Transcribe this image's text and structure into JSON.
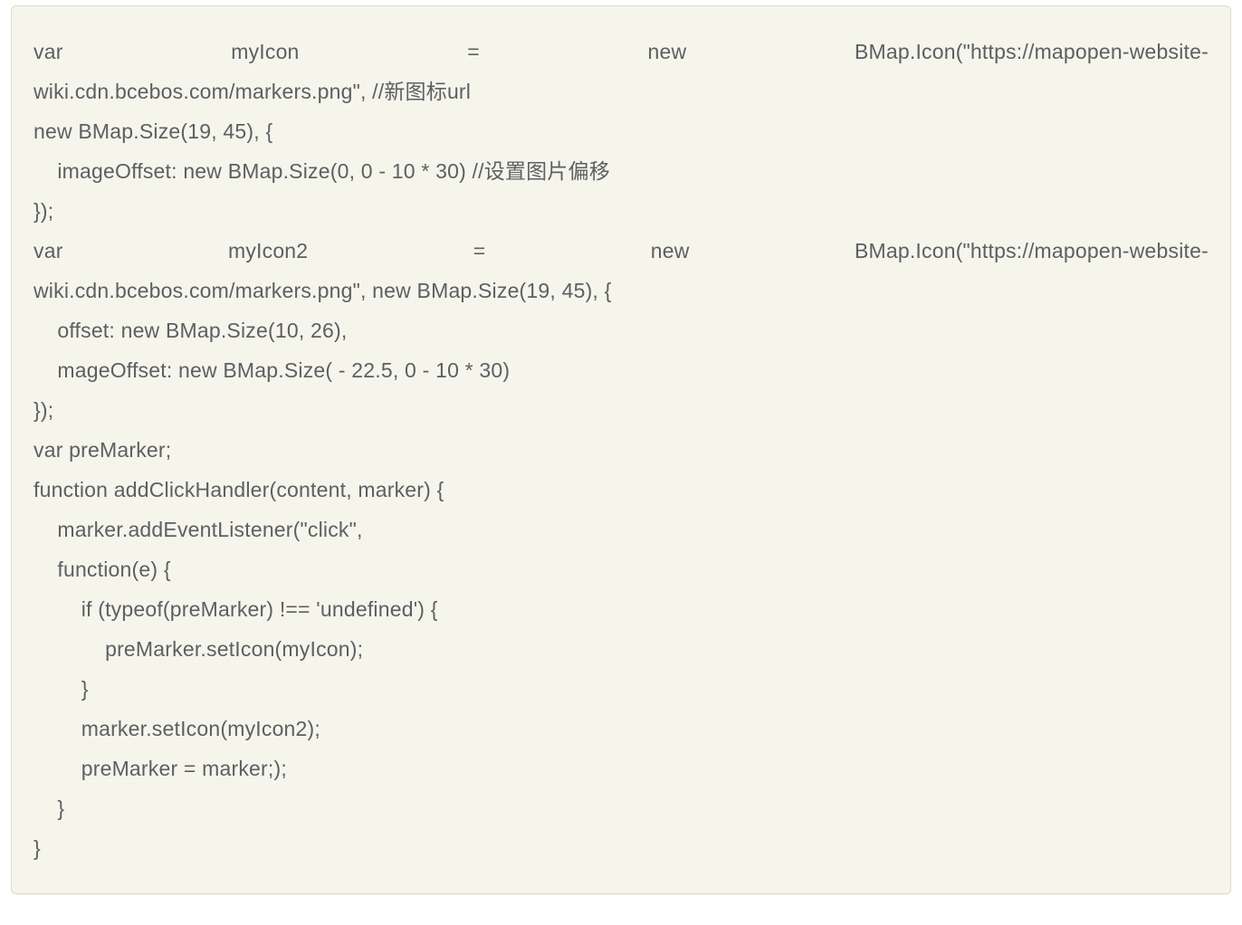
{
  "code": {
    "l01_tokens": [
      "var",
      "myIcon",
      "=",
      "new",
      "BMap.Icon(\"https://mapopen-website-"
    ],
    "l02": "wiki.cdn.bcebos.com/markers.png\", //新图标url",
    "l03": "new BMap.Size(19, 45), {",
    "l04": "    imageOffset: new BMap.Size(0, 0 - 10 * 30) //设置图片偏移",
    "l05": "});",
    "l06_tokens": [
      "var",
      "myIcon2",
      "=",
      "new",
      "BMap.Icon(\"https://mapopen-website-"
    ],
    "l07": "wiki.cdn.bcebos.com/markers.png\", new BMap.Size(19, 45), {",
    "l08": "    offset: new BMap.Size(10, 26),",
    "l09": "    mageOffset: new BMap.Size( - 22.5, 0 - 10 * 30)",
    "l10": "});",
    "l11": "var preMarker;",
    "l12": "function addClickHandler(content, marker) {",
    "l13": "    marker.addEventListener(\"click\",",
    "l14": "    function(e) {",
    "l15": "        if (typeof(preMarker) !== 'undefined') {",
    "l16": "            preMarker.setIcon(myIcon);",
    "l17": "        }",
    "l18": "        marker.setIcon(myIcon2);",
    "l19": "        preMarker = marker;);",
    "l20": "    }",
    "l21": "}"
  }
}
